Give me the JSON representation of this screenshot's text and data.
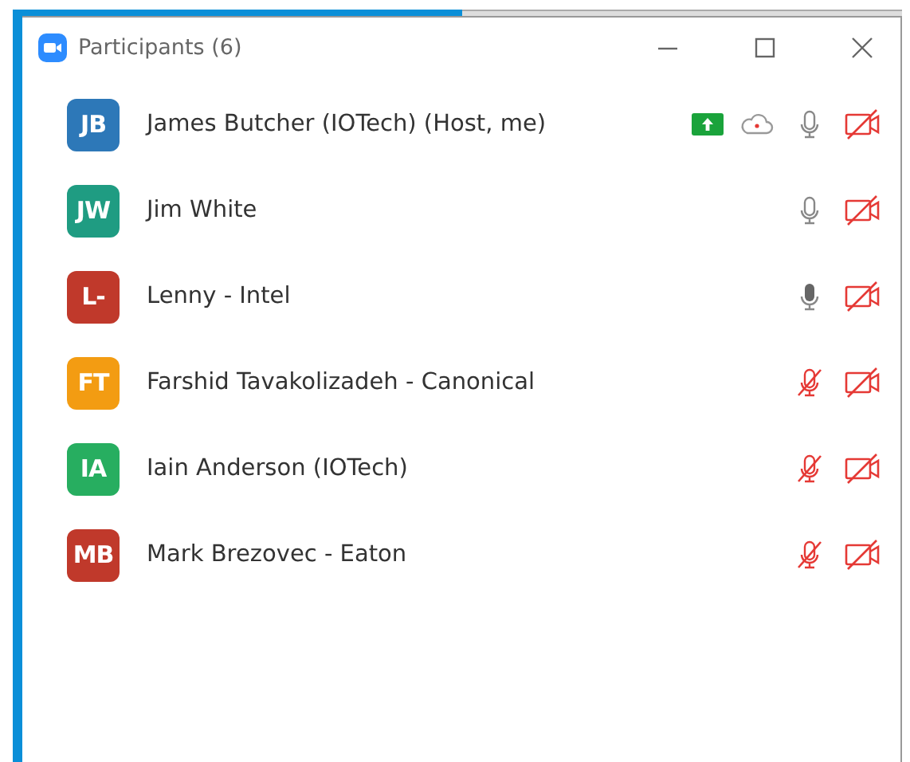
{
  "window": {
    "title": "Participants (6)"
  },
  "participants": [
    {
      "initials": "JB",
      "name": "James Butcher (IOTech) (Host, me)",
      "color": "#2d78b8",
      "sharing": true,
      "recording": true,
      "muted": false,
      "speaking": false,
      "video_on": false
    },
    {
      "initials": "JW",
      "name": "Jim White",
      "color": "#1f9c82",
      "sharing": false,
      "recording": false,
      "muted": false,
      "speaking": false,
      "video_on": false
    },
    {
      "initials": "L-",
      "name": "Lenny - Intel",
      "color": "#c0392b",
      "sharing": false,
      "recording": false,
      "muted": false,
      "speaking": true,
      "video_on": false
    },
    {
      "initials": "FT",
      "name": "Farshid Tavakolizadeh - Canonical",
      "color": "#f39c12",
      "sharing": false,
      "recording": false,
      "muted": true,
      "video_on": false
    },
    {
      "initials": "IA",
      "name": "Iain Anderson (IOTech)",
      "color": "#27ae60",
      "sharing": false,
      "recording": false,
      "muted": true,
      "video_on": false
    },
    {
      "initials": "MB",
      "name": "Mark Brezovec - Eaton",
      "color": "#c0392b",
      "sharing": false,
      "recording": false,
      "muted": true,
      "video_on": false
    }
  ]
}
